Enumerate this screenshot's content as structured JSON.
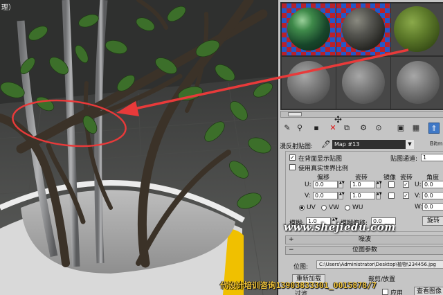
{
  "viewport": {
    "label": "理）",
    "colors": {
      "annotation": "#e83a3a",
      "pot_rim": "#d5d5d5",
      "pot_yellow": "#f0c000",
      "leaves": "#3c6f2a"
    }
  },
  "material_editor": {
    "slots": [
      {
        "name": "sample-slot-1",
        "material": "green-leaf",
        "background": "checker"
      },
      {
        "name": "sample-slot-2",
        "material": "dark-bark",
        "background": "checker"
      },
      {
        "name": "sample-slot-3",
        "material": "moss-green",
        "background": "gray",
        "selected": true
      },
      {
        "name": "sample-slot-4",
        "material": "default-gray",
        "background": "gray"
      },
      {
        "name": "sample-slot-5",
        "material": "default-gray",
        "background": "gray"
      },
      {
        "name": "sample-slot-6",
        "material": "default-gray",
        "background": "gray"
      }
    ],
    "map_row": {
      "label": "漫反射贴图:",
      "map_name": "Map #13",
      "type": "Bitma"
    },
    "coordinates": {
      "show_map_on_back": "在背面显示贴图",
      "use_real_world": "使用真实世界比例",
      "channel_label": "贴图通道:",
      "channel_value": "1",
      "offset_label": "偏移",
      "tiling_label": "瓷砖",
      "mirror_label": "镜像",
      "tile_label": "瓷砖",
      "angle_label": "角度",
      "u_label": "U:",
      "v_label": "V:",
      "w_label": "W:",
      "u_offset": "0.0",
      "v_offset": "0.0",
      "u_tiling": "1.0",
      "v_tiling": "1.0",
      "u_angle": "0.0",
      "v_angle": "0.0",
      "w_angle": "0.0",
      "uv": "UV",
      "vw": "VW",
      "wu": "WU",
      "blur_label": "模糊:",
      "blur_value": "1.0",
      "blur_offset_label": "模糊偏移:",
      "blur_offset_value": "0.0",
      "rotate_button": "旋转"
    },
    "noise_bar": "噪波",
    "bitmap_params_bar": "位图参数",
    "bitmap_label": "位图:",
    "bitmap_path": "C:\\Users\\Administrator\\Desktop\\植物\\234456.jpg",
    "reload_button": "重新加载",
    "crop_label": "裁剪/放置",
    "apply_label": "应用",
    "view_image_button": "查看图像",
    "filter_label": "过滤"
  },
  "overlays": {
    "watermark": "www.shejiedu.com",
    "contact": "代设计培训咨询13903833301_0015878/7"
  }
}
